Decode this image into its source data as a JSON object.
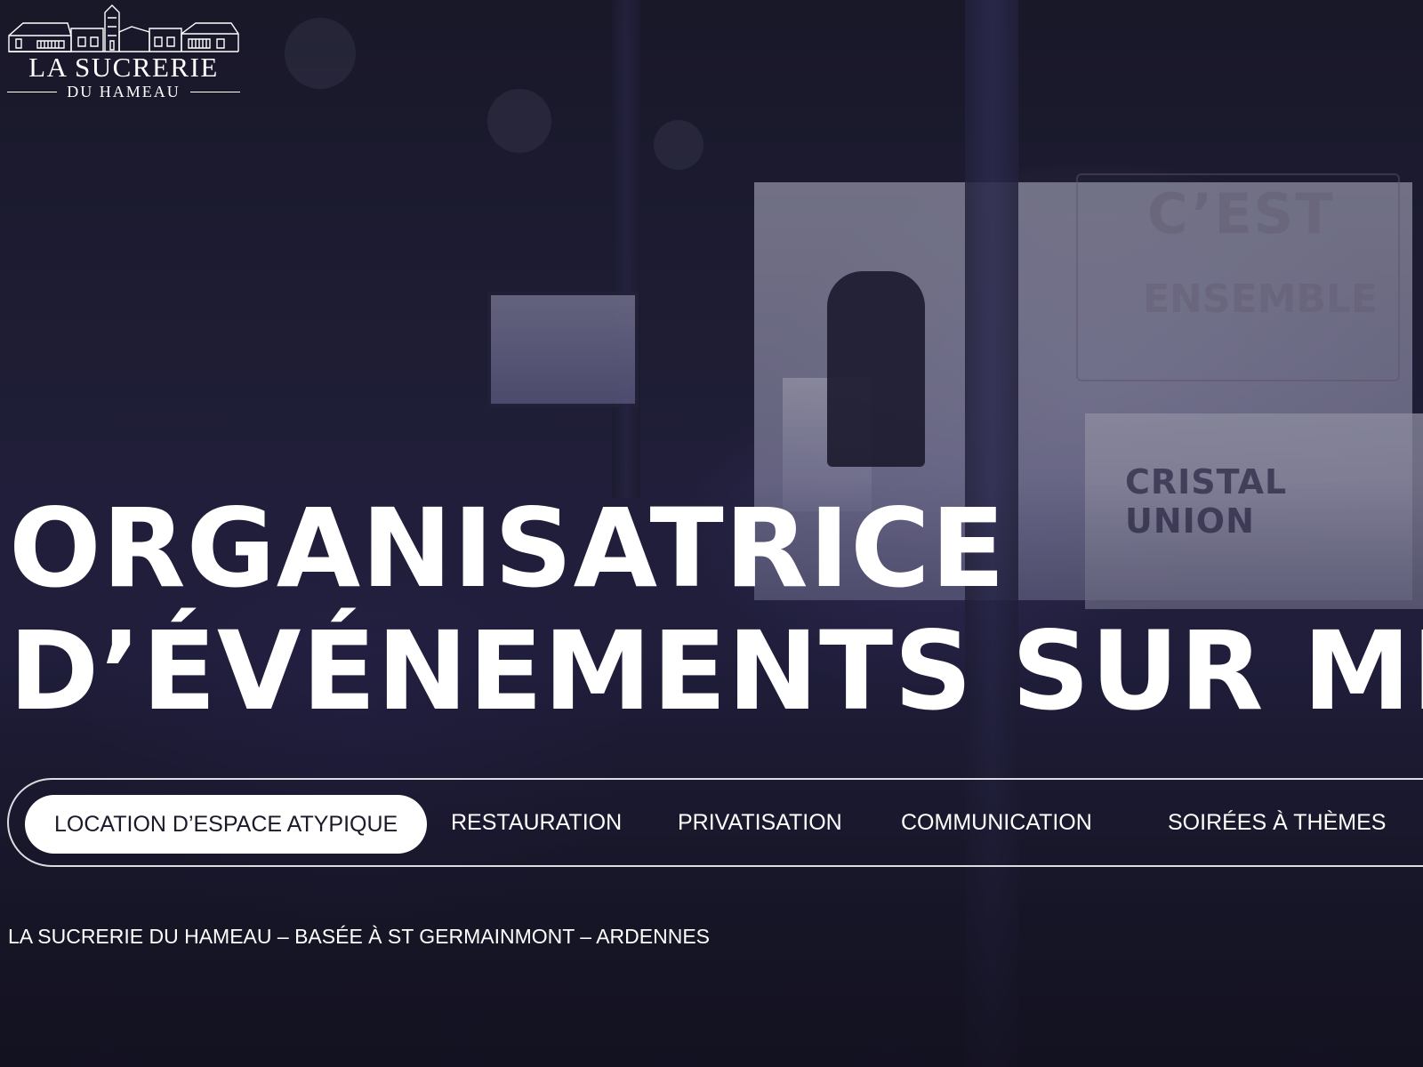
{
  "logo": {
    "title": "LA SUCRERIE",
    "subtitle": "DU HAMEAU"
  },
  "hero": {
    "headline_line1": "ORGANISATRICE",
    "headline_line2": "D’ÉVÉNEMENTS SUR MESURE"
  },
  "nav": {
    "items": [
      {
        "label": "LOCATION D’ESPACE ATYPIQUE",
        "active": true
      },
      {
        "label": "RESTAURATION",
        "active": false
      },
      {
        "label": "PRIVATISATION",
        "active": false
      },
      {
        "label": "COMMUNICATION",
        "active": false
      },
      {
        "label": "SOIRÉES À THÈMES",
        "active": false
      }
    ]
  },
  "tagline": "LA SUCRERIE DU HAMEAU – BASÉE À ST GERMAINMONT – ARDENNES",
  "background_scene": {
    "stage_text_1": "C’EST",
    "stage_text_2": "ENSEMBLE",
    "stage_brand": "CRISTAL UNION"
  },
  "colors": {
    "background": "#1c1a2c",
    "text": "#ffffff",
    "active_pill_bg": "#ffffff",
    "active_pill_text": "#1b1a2a"
  }
}
